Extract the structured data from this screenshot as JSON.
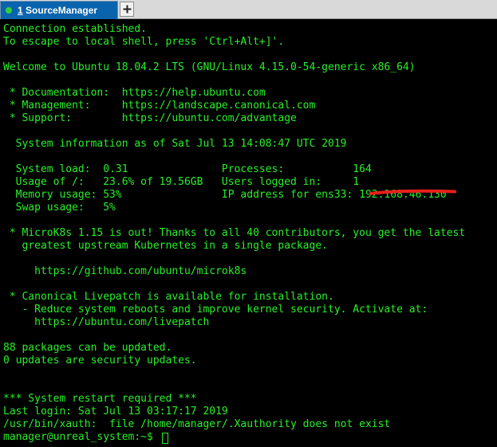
{
  "tab": {
    "number": "1",
    "title": "SourceManager",
    "status_color": "#32d13a",
    "add_icon": "plus-icon"
  },
  "colors": {
    "terminal_background": "#000000",
    "terminal_text": "#29ef29",
    "tab_active": "#0a64ad",
    "redaction": "#e8201a"
  },
  "terminal": {
    "lines": [
      "Connection established.",
      "To escape to local shell, press 'Ctrl+Alt+]'.",
      "",
      "Welcome to Ubuntu 18.04.2 LTS (GNU/Linux 4.15.0-54-generic x86_64)",
      "",
      " * Documentation:  https://help.ubuntu.com",
      " * Management:     https://landscape.canonical.com",
      " * Support:        https://ubuntu.com/advantage",
      "",
      "  System information as of Sat Jul 13 14:08:47 UTC 2019",
      "",
      "  System load:  0.31               Processes:           164",
      "  Usage of /:   23.6% of 19.56GB   Users logged in:     1",
      "  Memory usage: 53%                IP address for ens33: 192.168.46.130",
      "  Swap usage:   5%",
      "",
      " * MicroK8s 1.15 is out! Thanks to all 40 contributors, you get the latest",
      "   greatest upstream Kubernetes in a single package.",
      "",
      "     https://github.com/ubuntu/microk8s",
      "",
      " * Canonical Livepatch is available for installation.",
      "   - Reduce system reboots and improve kernel security. Activate at:",
      "     https://ubuntu.com/livepatch",
      "",
      "88 packages can be updated.",
      "0 updates are security updates.",
      "",
      "",
      "*** System restart required ***",
      "Last login: Sat Jul 13 03:17:17 2019",
      "/usr/bin/xauth:  file /home/manager/.Xauthority does not exist",
      "manager@unreal_system:~$ "
    ]
  }
}
